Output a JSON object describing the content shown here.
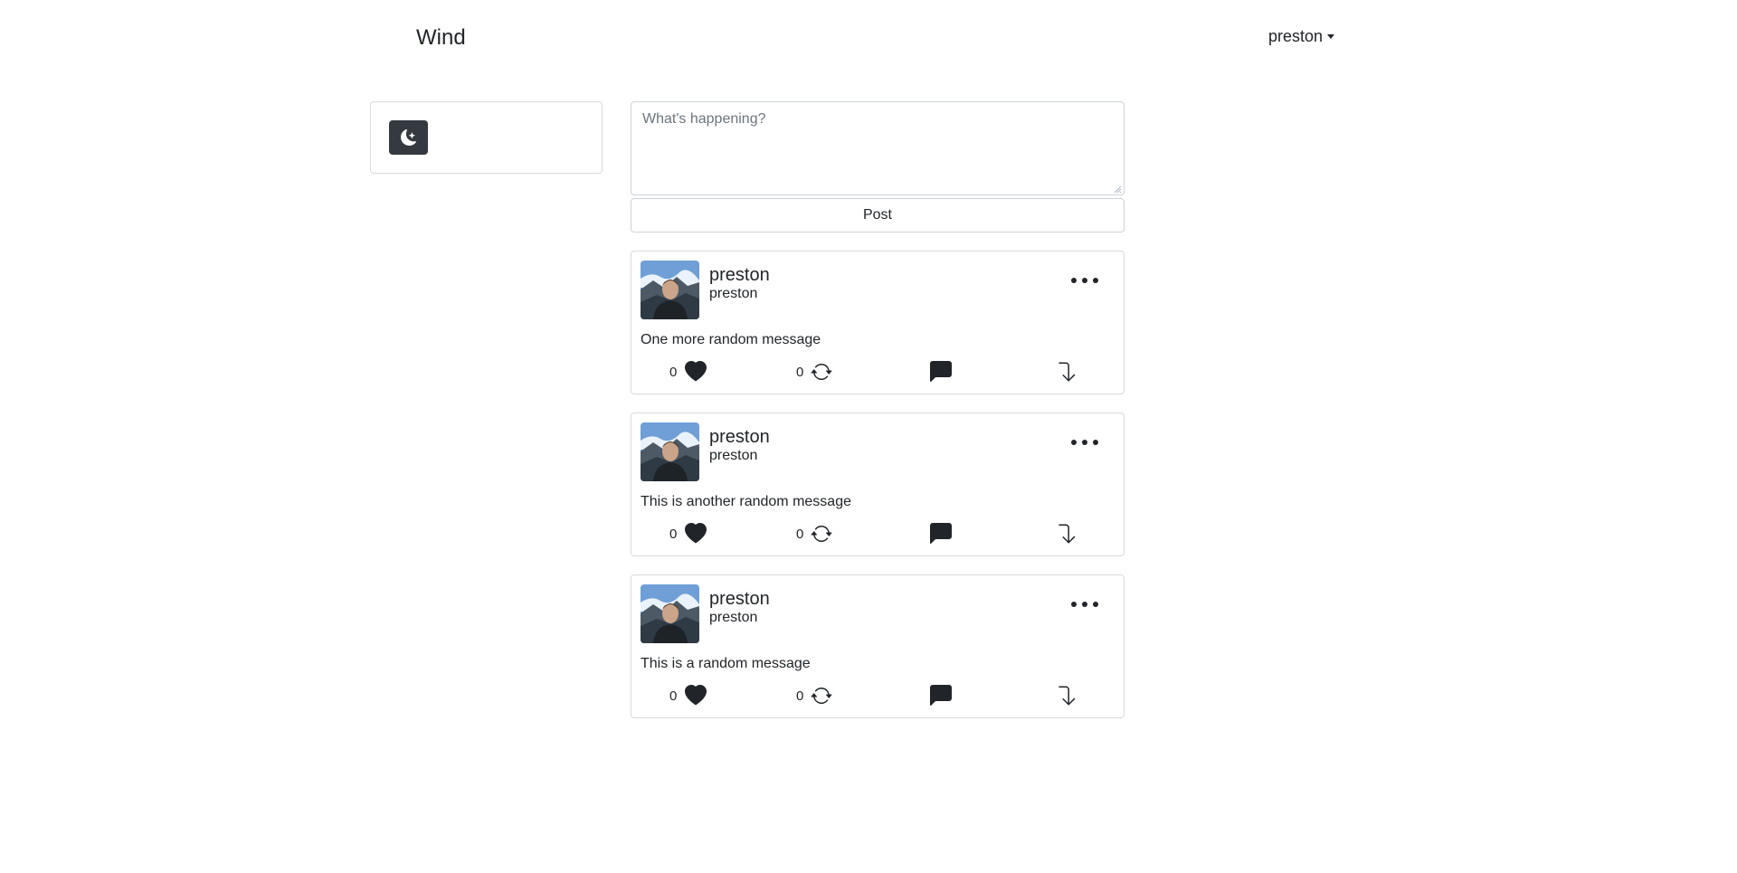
{
  "navbar": {
    "brand": "Wind",
    "user": "preston"
  },
  "sidebar": {
    "theme_toggle_icon": "moon-stars-icon"
  },
  "composer": {
    "placeholder": "What's happening?",
    "value": "",
    "post_label": "Post"
  },
  "posts": [
    {
      "name": "preston",
      "handle": "preston",
      "message": "One more random message",
      "likes": "0",
      "retweets": "0"
    },
    {
      "name": "preston",
      "handle": "preston",
      "message": "This is another random message",
      "likes": "0",
      "retweets": "0"
    },
    {
      "name": "preston",
      "handle": "preston",
      "message": "This is a random message",
      "likes": "0",
      "retweets": "0"
    }
  ],
  "icons": {
    "like": "heart-icon",
    "retweet": "retweet-icon",
    "reply": "comment-icon",
    "share": "share-icon",
    "more": "more-icon"
  },
  "colors": {
    "dark_button": "#343a40",
    "text": "#212529",
    "border": "#ced4da"
  }
}
